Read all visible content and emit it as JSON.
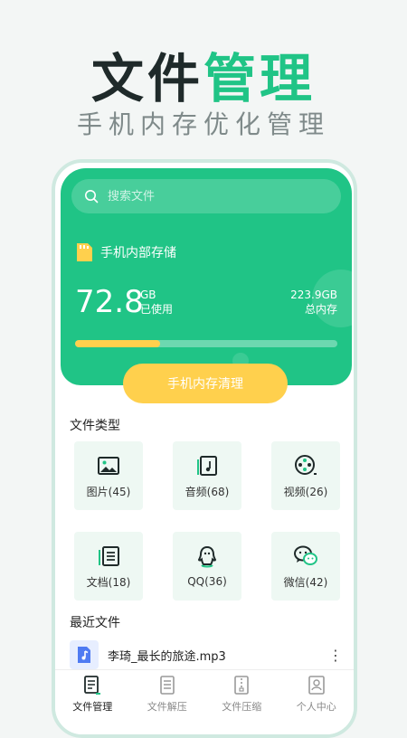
{
  "headline": {
    "part1": "文件",
    "part2": "管理"
  },
  "subheadline": "手机内存优化管理",
  "search": {
    "placeholder": "搜索文件"
  },
  "storage": {
    "title": "手机内部存储",
    "used_value": "72.8",
    "used_unit": "GB",
    "used_label": "已使用",
    "total_value": "223.9GB",
    "total_label": "总内存",
    "usage_fraction": 0.325
  },
  "clean_button": "手机内存清理",
  "file_types": {
    "title": "文件类型",
    "items": [
      {
        "label": "图片(45)",
        "icon": "image-icon"
      },
      {
        "label": "音频(68)",
        "icon": "audio-icon"
      },
      {
        "label": "视频(26)",
        "icon": "video-icon"
      },
      {
        "label": "文档(18)",
        "icon": "document-icon"
      },
      {
        "label": "QQ(36)",
        "icon": "qq-icon"
      },
      {
        "label": "微信(42)",
        "icon": "wechat-icon"
      }
    ]
  },
  "recent": {
    "title": "最近文件",
    "items": [
      {
        "name": "李琦_最长的旅途.mp3",
        "icon": "music-file-icon"
      }
    ]
  },
  "nav": [
    {
      "label": "文件管理",
      "icon": "file-manage-icon",
      "active": true
    },
    {
      "label": "文件解压",
      "icon": "unzip-icon",
      "active": false
    },
    {
      "label": "文件压缩",
      "icon": "zip-icon",
      "active": false
    },
    {
      "label": "个人中心",
      "icon": "profile-icon",
      "active": false
    }
  ],
  "colors": {
    "accent": "#20c486",
    "yellow": "#ffd04d",
    "tile_bg": "#eef8f3",
    "text_dark": "#1f2a2a"
  }
}
